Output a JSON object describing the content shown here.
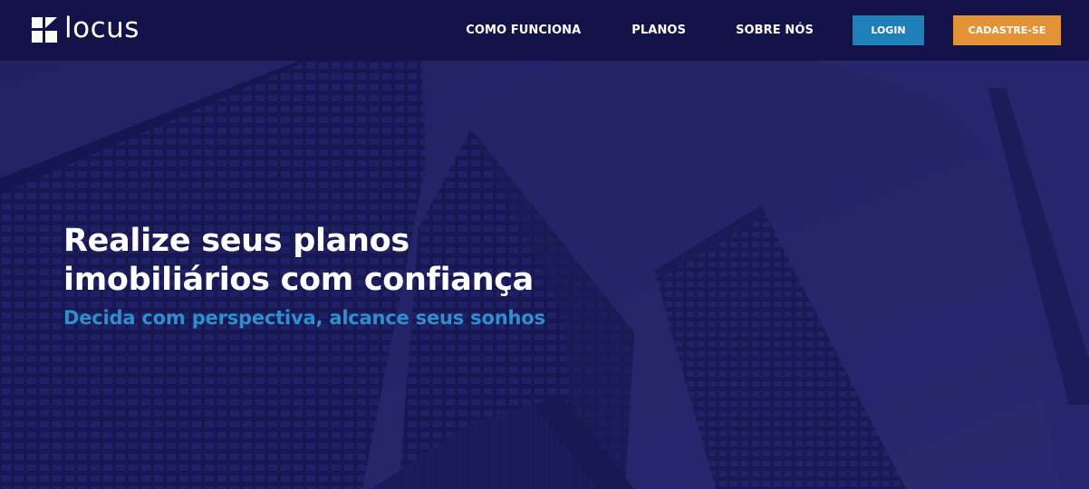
{
  "header": {
    "brand": "locus",
    "nav": [
      {
        "label": "COMO FUNCIONA"
      },
      {
        "label": "PLANOS"
      },
      {
        "label": "SOBRE NÓS"
      }
    ],
    "login_label": "LOGIN",
    "signup_label": "CADASTRE-SE"
  },
  "hero": {
    "title": "Realize seus planos\nimobiliários com confiança",
    "subtitle": "Decida com perspectiva, alcance seus sonhos"
  },
  "colors": {
    "header_bg": "#13134a",
    "hero_overlay": "#1c1c5e",
    "login_button": "#1f7fb8",
    "signup_button": "#e39236",
    "subtitle": "#2e8fcd"
  }
}
